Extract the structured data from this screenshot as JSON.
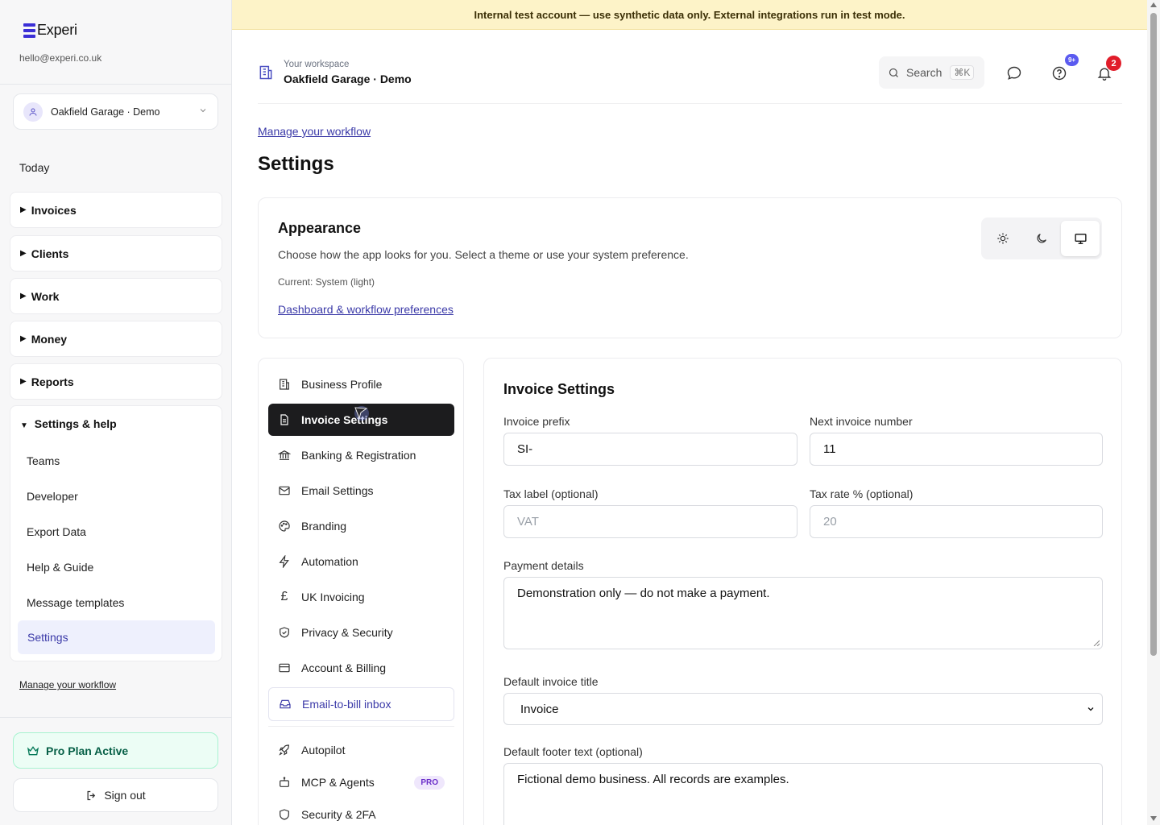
{
  "sidebar": {
    "brand": "Experi",
    "email": "hello@experi.co.uk",
    "workspace_select": "Oakfield Garage · Demo",
    "today": "Today",
    "groups": [
      {
        "label": "Invoices",
        "marker": "▶"
      },
      {
        "label": "Clients",
        "marker": "▶"
      },
      {
        "label": "Work",
        "marker": "▶"
      },
      {
        "label": "Money",
        "marker": "▶"
      },
      {
        "label": "Reports",
        "marker": "▶"
      }
    ],
    "settings_group": {
      "label": "Settings & help",
      "marker": "▼",
      "items": [
        "Teams",
        "Developer",
        "Export Data",
        "Help & Guide",
        "Message templates",
        "Settings"
      ]
    },
    "manage_link": "Manage your workflow",
    "pro_plan": "Pro Plan Active",
    "sign_out": "Sign out"
  },
  "banner": "Internal test account — use synthetic data only. External integrations run in test mode.",
  "header": {
    "workspace_label": "Your workspace",
    "workspace_name": "Oakfield Garage · Demo",
    "search_label": "Search",
    "search_shortcut": "⌘K",
    "help_badge": "9+",
    "notification_count": "2"
  },
  "main": {
    "manage_link": "Manage your workflow",
    "title": "Settings",
    "appearance": {
      "title": "Appearance",
      "description": "Choose how the app looks for you. Select a theme or use your system preference.",
      "current": "Current: System (light)",
      "link": "Dashboard & workflow preferences",
      "theme_options": [
        "light",
        "dark",
        "system"
      ],
      "selected_theme": "system"
    },
    "settings_nav": [
      {
        "label": "Business Profile",
        "icon": "building-icon"
      },
      {
        "label": "Invoice Settings",
        "icon": "document-icon",
        "active": true
      },
      {
        "label": "Banking & Registration",
        "icon": "bank-icon"
      },
      {
        "label": "Email Settings",
        "icon": "mail-icon"
      },
      {
        "label": "Branding",
        "icon": "palette-icon"
      },
      {
        "label": "Automation",
        "icon": "lightning-icon"
      },
      {
        "label": "UK Invoicing",
        "icon": "pound-icon"
      },
      {
        "label": "Privacy & Security",
        "icon": "shield-check-icon"
      },
      {
        "label": "Account & Billing",
        "icon": "credit-card-icon"
      },
      {
        "label": "Email-to-bill inbox",
        "icon": "inbox-icon"
      },
      {
        "label": "Autopilot",
        "icon": "rocket-icon"
      },
      {
        "label": "MCP & Agents",
        "icon": "robot-icon",
        "badge": "PRO"
      },
      {
        "label": "Security & 2FA",
        "icon": "shield-icon"
      }
    ],
    "invoice_settings": {
      "title": "Invoice Settings",
      "prefix_label": "Invoice prefix",
      "prefix_value": "SI-",
      "next_number_label": "Next invoice number",
      "next_number_value": "11",
      "tax_label_label": "Tax label (optional)",
      "tax_label_placeholder": "VAT",
      "tax_rate_label": "Tax rate % (optional)",
      "tax_rate_placeholder": "20",
      "payment_label": "Payment details",
      "payment_value": "Demonstration only — do not make a payment.",
      "default_title_label": "Default invoice title",
      "default_title_value": "Invoice",
      "footer_label": "Default footer text (optional)",
      "footer_value": "Fictional demo business. All records are examples."
    }
  },
  "colors": {
    "accent": "#3b3aa8",
    "brand": "#3b2fd6",
    "banner_bg": "#fdf3c8",
    "active_nav_bg": "#1c1c1e",
    "badge_red": "#e11d2a",
    "badge_purple": "#5b5bf0"
  }
}
